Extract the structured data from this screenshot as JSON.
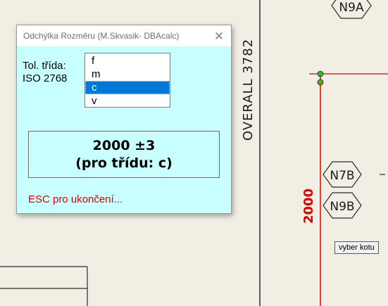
{
  "drawing": {
    "dimension_overall": "OVERALL 3782",
    "dimension_red": "2000",
    "tags": [
      "N9A",
      "N7B",
      "N9B"
    ],
    "colors": {
      "background": "#f1efe3",
      "line": "#2a2a2a",
      "red_dimension": "#e00000",
      "marker": "#22c022"
    }
  },
  "tooltip": {
    "text": "vyber kotu"
  },
  "dialog": {
    "title": "Odchýlka Rozměru (M.Skvasik- DBAcalc)",
    "close_symbol": "✕",
    "tol_label_line1": "Tol. třída:",
    "tol_label_line2": "ISO 2768",
    "tolerance_classes": [
      {
        "label": "f",
        "selected": false
      },
      {
        "label": "m",
        "selected": false
      },
      {
        "label": "c",
        "selected": true
      },
      {
        "label": "v",
        "selected": false
      }
    ],
    "result_line1": "2000 ±3",
    "result_line2": "(pro třídu: c)",
    "esc_text": "ESC pro ukončení...",
    "colors": {
      "background": "#c8ffff",
      "selection": "#0078d7",
      "esc_text": "#e00000"
    }
  }
}
